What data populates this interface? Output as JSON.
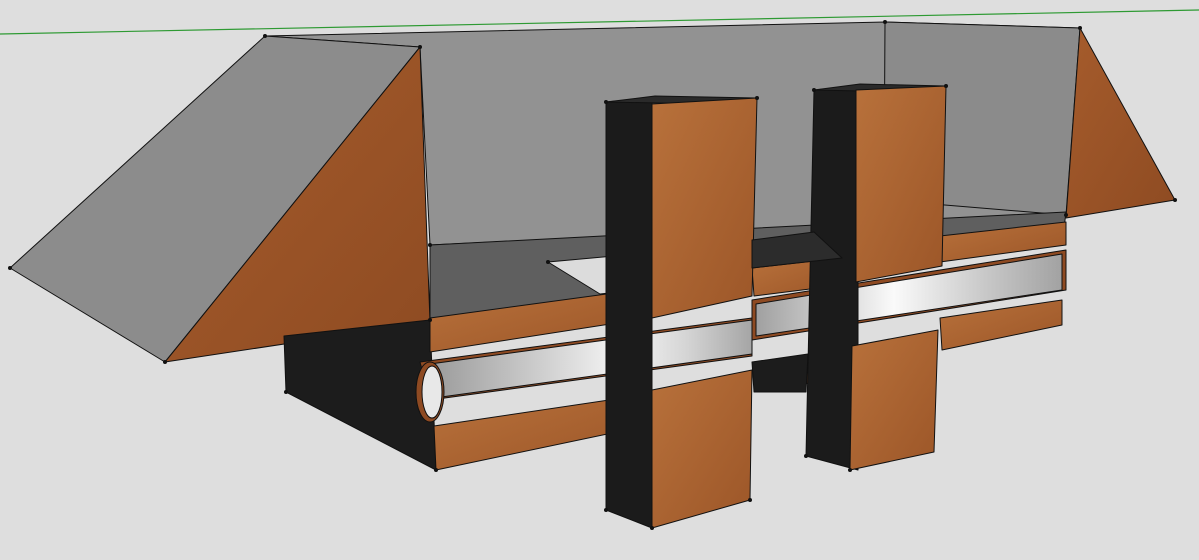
{
  "scene": {
    "description_tag": "3d-model-viewport",
    "colors": {
      "background": "#dedede",
      "horizon": "#2e9a33",
      "wood_light": "#b56a34",
      "wood_mid": "#9a5428",
      "wood_dark": "#7d4020",
      "shadow": "#1c1c1c",
      "inner_grey_light": "#a8a8a8",
      "inner_grey_mid": "#8a8a8a",
      "inner_grey_dark": "#5c5c5c",
      "pipe_light": "#f4f4f4",
      "pipe_mid": "#bdbdbd",
      "edge": "#111111"
    }
  }
}
